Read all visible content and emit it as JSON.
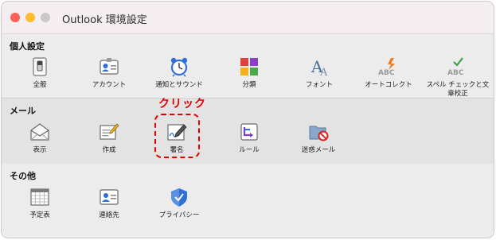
{
  "window": {
    "title": "Outlook 環境設定"
  },
  "sections": [
    {
      "heading": "個人設定",
      "items": [
        {
          "label": "全般",
          "icon": "switch-icon"
        },
        {
          "label": "アカウント",
          "icon": "account-card-icon"
        },
        {
          "label": "通知とサウンド",
          "icon": "alarm-clock-icon"
        },
        {
          "label": "分類",
          "icon": "category-squares-icon"
        },
        {
          "label": "フォント",
          "icon": "font-icon"
        },
        {
          "label": "オートコレクト",
          "icon": "autocorrect-icon"
        },
        {
          "label": "スペル チェックと文章校正",
          "icon": "spellcheck-icon"
        }
      ]
    },
    {
      "heading": "メール",
      "items": [
        {
          "label": "表示",
          "icon": "open-envelope-icon"
        },
        {
          "label": "作成",
          "icon": "compose-icon"
        },
        {
          "label": "署名",
          "icon": "signature-pen-icon"
        },
        {
          "label": "ルール",
          "icon": "rules-icon"
        },
        {
          "label": "迷惑メール",
          "icon": "junk-folder-icon"
        }
      ]
    },
    {
      "heading": "その他",
      "items": [
        {
          "label": "予定表",
          "icon": "calendar-icon"
        },
        {
          "label": "連絡先",
          "icon": "contacts-icon"
        },
        {
          "label": "プライバシー",
          "icon": "shield-icon"
        }
      ]
    }
  ],
  "annotation": {
    "text": "クリック",
    "color": "#e00000"
  },
  "colors": {
    "accent": "#2f6fd6",
    "highlight": "#e00000"
  }
}
